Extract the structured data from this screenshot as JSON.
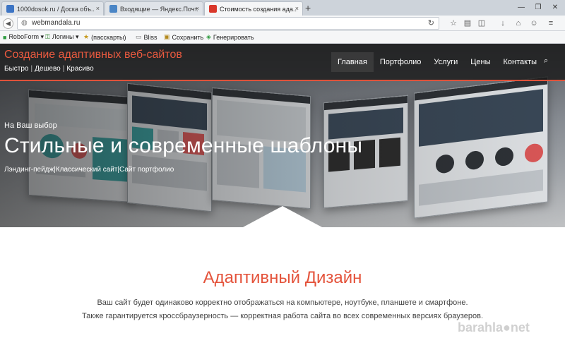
{
  "browser": {
    "tabs": [
      {
        "label": "1000dosok.ru / Доска объ...",
        "fav_color": "#3c74c4",
        "close": "×"
      },
      {
        "label": "Входящие — Яндекс.Почт...",
        "fav_color": "#4b86c6",
        "close": "×"
      },
      {
        "label": "Стоимость создания ада...",
        "fav_color": "#d9372a",
        "close": "×"
      }
    ],
    "new_tab": "+",
    "window_controls": {
      "minimize": "—",
      "maximize": "❐",
      "close": "✕"
    },
    "url": "webmandala.ru",
    "bookmarks": [
      {
        "label": "RoboForm ▾",
        "icon": "roboform-icon"
      },
      {
        "label": "Логины ▾",
        "icon": "key-icon"
      },
      {
        "label": "(пасскарты)",
        "icon": "star-icon"
      },
      {
        "label": "Bliss",
        "icon": "page-icon"
      },
      {
        "label": "Сохранить",
        "icon": "save-icon"
      },
      {
        "label": "Генерировать",
        "icon": "generate-icon"
      }
    ]
  },
  "site": {
    "title": "Создание адаптивных веб-сайтов",
    "tagline": [
      "Быстро",
      "Дешево",
      "Красиво"
    ],
    "nav": [
      {
        "label": "Главная",
        "active": true
      },
      {
        "label": "Портфолио",
        "active": false
      },
      {
        "label": "Услуги",
        "active": false
      },
      {
        "label": "Цены",
        "active": false
      },
      {
        "label": "Контакты",
        "active": false
      }
    ],
    "hero": {
      "kicker": "На Ваш выбор",
      "title": "Стильные и современные шаблоны",
      "subtitle": "Лэндинг-пейдж|Классический сайт|Сайт портфолио"
    },
    "section": {
      "title": "Адаптивный Дизайн",
      "line1": "Ваш сайт будет одинаково корректно отображаться на компьютере, ноутбуке, планшете и смартфоне.",
      "line2": "Также гарантируется кроссбраузерность — корректная работа сайта во всех современных версиях браузеров."
    },
    "watermark": "barahla●net"
  },
  "colors": {
    "accent": "#e4533b",
    "nav_bg": "#1e1e1e"
  }
}
